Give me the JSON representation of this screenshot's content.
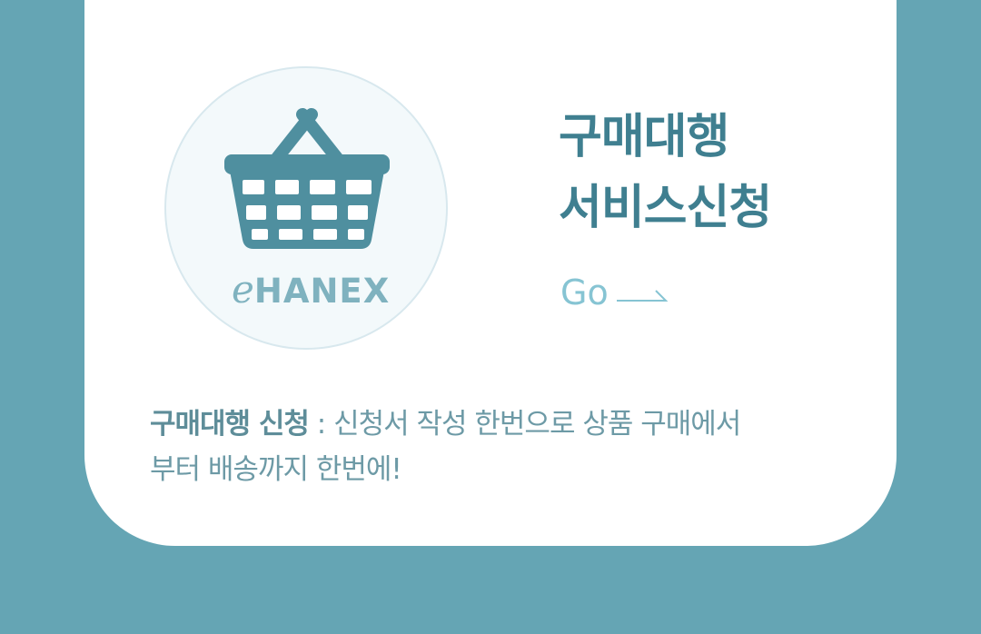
{
  "brand": {
    "logo_e": "e",
    "logo_text": "HANEX"
  },
  "service": {
    "title_line1": "구매대행",
    "title_line2": "서비스신청",
    "go_label": "Go"
  },
  "description": {
    "highlight": "구매대행 신청",
    "separator": " : ",
    "line1_rest": "신청서 작성 한번으로 상품 구매에서",
    "line2": "부터 배송까지 한번에!"
  },
  "icons": {
    "basket": "shopping-basket-icon",
    "arrow": "arrow-right-icon"
  },
  "colors": {
    "background": "#65a5b4",
    "card": "#ffffff",
    "title": "#3f7f90",
    "basket": "#4f8f9f",
    "brand": "#7fb2bf",
    "go": "#86c4d3",
    "description": "#6d9aa6"
  }
}
